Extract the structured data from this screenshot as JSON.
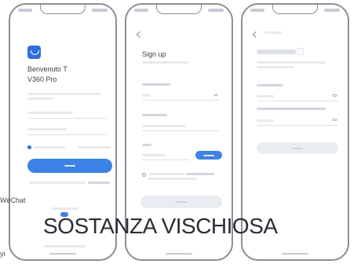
{
  "login": {
    "welcome_line1": "Benvenuto T",
    "welcome_line2": "V360 Pro"
  },
  "signup": {
    "title": "Sign up"
  },
  "side_labels": {
    "wechat": "WeChat",
    "yi": "yi"
  },
  "overlay_caption": "SOSTANZA VISCHIOSA",
  "colors": {
    "accent": "#3d82e6",
    "logo": "#2f6fe0",
    "phone_frame": "#8a8f96"
  }
}
